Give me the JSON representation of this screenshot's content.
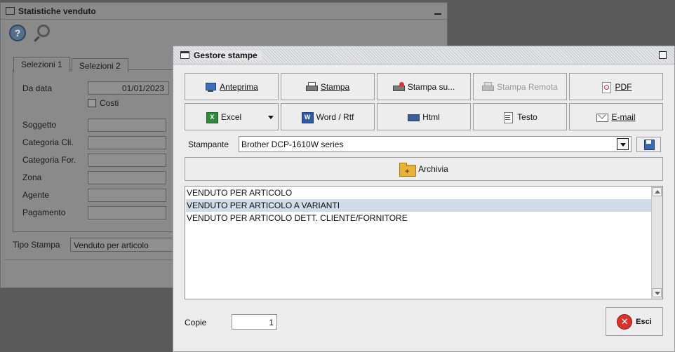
{
  "bg_window": {
    "title": "Statistiche venduto",
    "tabs": [
      "Selezioni 1",
      "Selezioni 2"
    ],
    "fields": [
      {
        "label": "Da data",
        "value": "01/01/2023"
      },
      {
        "label": "Soggetto",
        "value": ""
      },
      {
        "label": "Categoria Cli.",
        "value": ""
      },
      {
        "label": "Categoria For.",
        "value": ""
      },
      {
        "label": "Zona",
        "value": ""
      },
      {
        "label": "Agente",
        "value": ""
      },
      {
        "label": "Pagamento",
        "value": ""
      }
    ],
    "costi_label": "Costi",
    "tipo_stampa_label": "Tipo Stampa",
    "tipo_stampa_value": "Venduto per articolo"
  },
  "dialog": {
    "title": "Gestore stampe",
    "buttons_row1": [
      "Anteprima",
      "Stampa",
      "Stampa su...",
      "Stampa Remota",
      "PDF"
    ],
    "buttons_row2": [
      "Excel",
      "Word / Rtf",
      "Html",
      "Testo",
      "E-mail"
    ],
    "printer_label": "Stampante",
    "printer_value": "Brother DCP-1610W series",
    "archive_label": "Archivia",
    "reports": [
      "VENDUTO PER ARTICOLO",
      "VENDUTO PER ARTICOLO A VARIANTI",
      "VENDUTO PER ARTICOLO DETT. CLIENTE/FORNITORE"
    ],
    "selected_report_index": 1,
    "copies_label": "Copie",
    "copies_value": "1",
    "exit_label": "Esci"
  },
  "colors": {
    "selection": "#cfdbe6",
    "disabled_text": "#9a9a9a",
    "exit_icon": "#d9332b"
  }
}
